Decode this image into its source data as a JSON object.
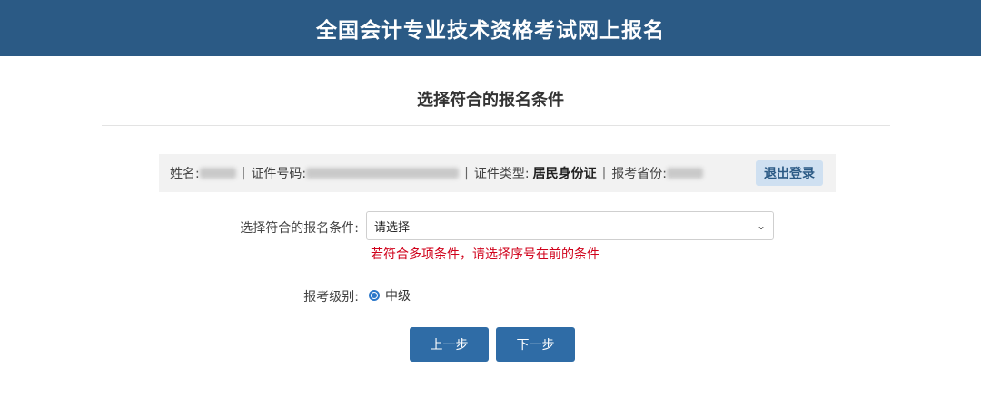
{
  "header": {
    "title": "全国会计专业技术资格考试网上报名"
  },
  "page": {
    "subtitle": "选择符合的报名条件"
  },
  "infobar": {
    "name_label": "姓名:",
    "id_label": "证件号码:",
    "id_type_label": "证件类型:",
    "id_type_value": "居民身份证",
    "province_label": "报考省份:",
    "separator": "|",
    "logout_label": "退出登录"
  },
  "form": {
    "condition_label": "选择符合的报名条件:",
    "condition_selected": "请选择",
    "condition_hint": "若符合多项条件，请选择序号在前的条件",
    "level_label": "报考级别:",
    "level_option": "中级"
  },
  "buttons": {
    "prev": "上一步",
    "next": "下一步"
  },
  "colors": {
    "header_bg": "#2b5a85",
    "primary_button": "#2f6ca6",
    "hint_red": "#d0021b"
  }
}
